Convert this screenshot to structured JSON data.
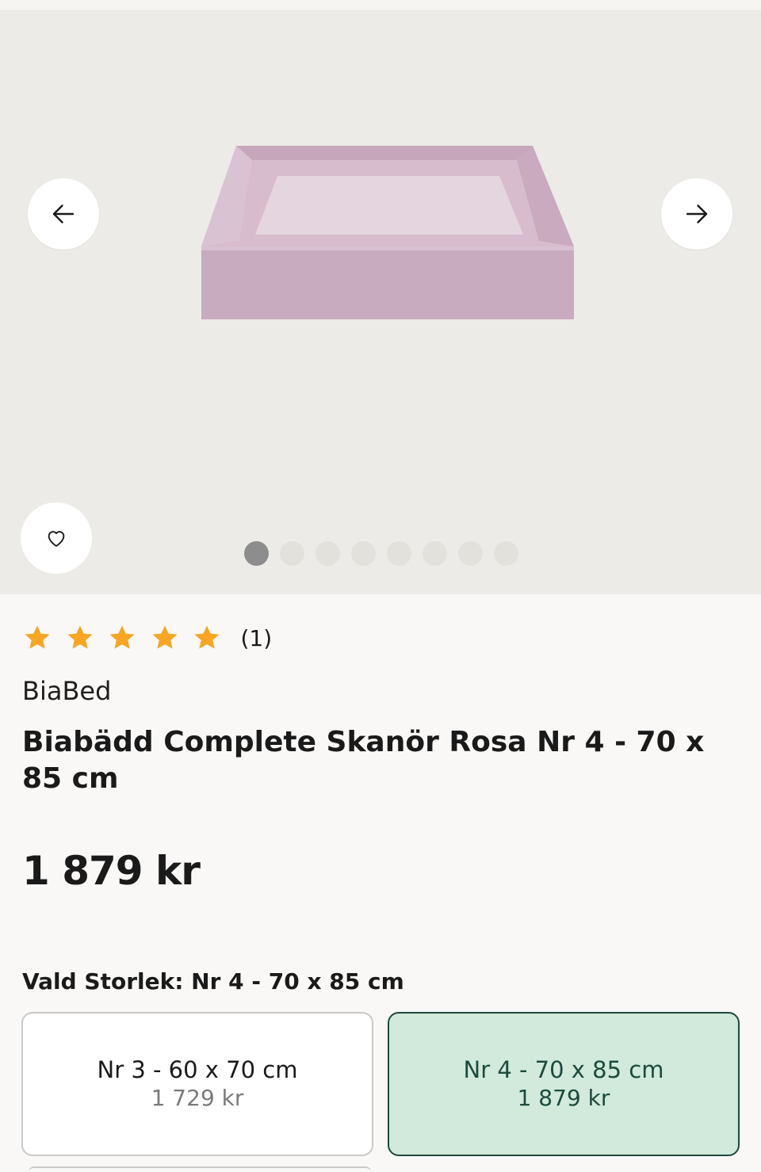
{
  "product": {
    "rating": {
      "stars": 5,
      "max": 5,
      "count_text": "(1)"
    },
    "brand": "BiaBed",
    "title": "Biabädd Complete Skanör Rosa Nr 4 - 70 x 85 cm",
    "price": "1 879 kr"
  },
  "gallery": {
    "image_count": 8,
    "active_index": 0,
    "icons": {
      "prev": "arrow-left-icon",
      "next": "arrow-right-icon",
      "favorite": "heart-icon"
    }
  },
  "size_selector": {
    "label": "Vald Storlek: Nr 4 - 70 x 85 cm",
    "options": [
      {
        "name": "Nr 3 - 60 x 70 cm",
        "price": "1 729 kr",
        "selected": false
      },
      {
        "name": "Nr 4 - 70 x 85 cm",
        "price": "1 879 kr",
        "selected": true
      }
    ]
  },
  "colors": {
    "star": "#f6a623",
    "selected_bg": "#d1eadb",
    "selected_border": "#1d4a3e",
    "bed_pink": "#cfb1c6"
  }
}
